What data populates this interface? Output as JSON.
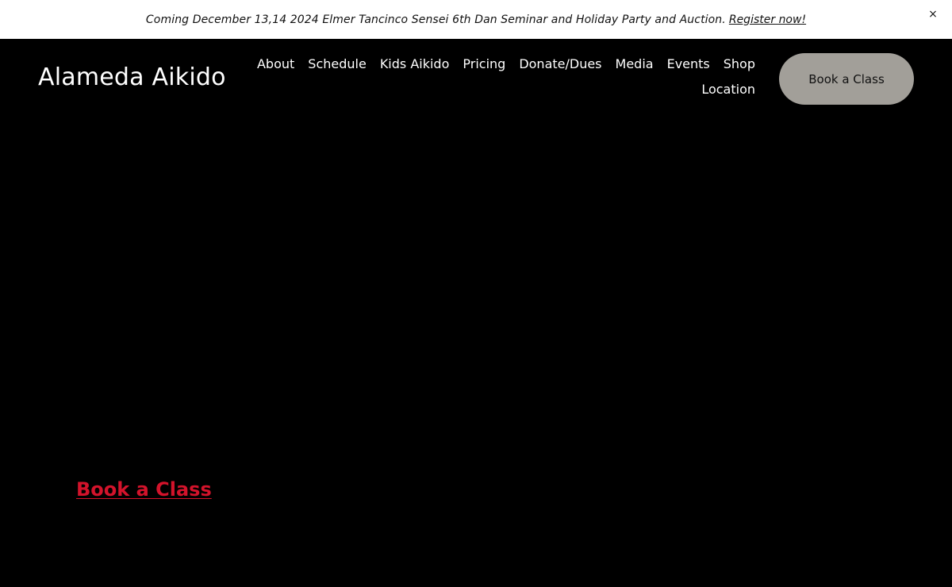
{
  "announcement": {
    "text": "Coming December 13,14 2024 Elmer Tancinco Sensei 6th Dan Seminar and Holiday Party and Auction.",
    "link_label": "Register now!",
    "close_icon": "close-icon",
    "close_glyph": "×"
  },
  "header": {
    "site_title": "Alameda Aikido",
    "nav": [
      {
        "label": "About"
      },
      {
        "label": "Schedule"
      },
      {
        "label": "Kids Aikido"
      },
      {
        "label": "Pricing"
      },
      {
        "label": "Donate/Dues"
      },
      {
        "label": "Media"
      },
      {
        "label": "Events"
      },
      {
        "label": "Shop"
      },
      {
        "label": "Location"
      }
    ],
    "cta_label": "Book a Class"
  },
  "hero": {
    "link_label": "Book a Class"
  },
  "colors": {
    "background": "#000000",
    "announcement_bg": "#ffffff",
    "cta_bg": "#a29f99",
    "accent_red": "#d3132b"
  }
}
